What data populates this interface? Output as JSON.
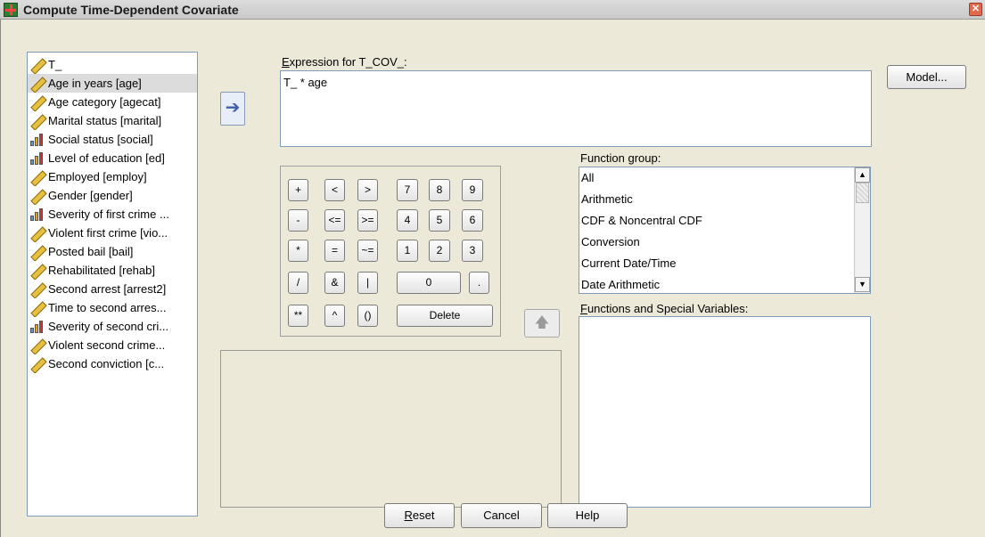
{
  "window": {
    "title": "Compute Time-Dependent Covariate",
    "close_glyph": "✕"
  },
  "variables": [
    {
      "label": "T_",
      "icon": "scale-ruler-icon"
    },
    {
      "label": "Age in years [age]",
      "icon": "scale-ruler-icon",
      "selected": true
    },
    {
      "label": "Age category [agecat]",
      "icon": "scale-ruler-icon"
    },
    {
      "label": "Marital status [marital]",
      "icon": "scale-ruler-icon"
    },
    {
      "label": "Social status [social]",
      "icon": "ordinal-bars-icon"
    },
    {
      "label": "Level of education [ed]",
      "icon": "ordinal-bars-icon"
    },
    {
      "label": "Employed [employ]",
      "icon": "scale-ruler-icon"
    },
    {
      "label": "Gender [gender]",
      "icon": "scale-ruler-icon"
    },
    {
      "label": "Severity of first crime ...",
      "icon": "ordinal-bars-icon"
    },
    {
      "label": "Violent first crime [vio...",
      "icon": "scale-ruler-icon"
    },
    {
      "label": "Posted bail [bail]",
      "icon": "scale-ruler-icon"
    },
    {
      "label": "Rehabilitated [rehab]",
      "icon": "scale-ruler-icon"
    },
    {
      "label": "Second arrest [arrest2]",
      "icon": "scale-ruler-icon"
    },
    {
      "label": "Time to second arres...",
      "icon": "scale-ruler-icon"
    },
    {
      "label": "Severity of second cri...",
      "icon": "ordinal-bars-icon"
    },
    {
      "label": "Violent second crime...",
      "icon": "scale-ruler-icon"
    },
    {
      "label": "Second conviction [c...",
      "icon": "scale-ruler-icon"
    }
  ],
  "move_button": {
    "glyph": "➔"
  },
  "expression": {
    "label_u": "E",
    "label_rest": "xpression for T_COV_:",
    "value": "T_ * age"
  },
  "model_button": {
    "label": "Model..."
  },
  "keypad": {
    "keys": [
      "+",
      "<",
      ">",
      "7",
      "8",
      "9",
      "-",
      "<=",
      ">=",
      "4",
      "5",
      "6",
      "*",
      "=",
      "~=",
      "1",
      "2",
      "3",
      "/",
      "&",
      "|",
      "0",
      ".",
      "**",
      "^",
      "()",
      "Delete"
    ]
  },
  "up_button": {
    "glyph": "🡅"
  },
  "function_group": {
    "label_pre": "Function ",
    "label_u": "g",
    "label_post": "roup:",
    "items": [
      "All",
      "Arithmetic",
      "CDF & Noncentral CDF",
      "Conversion",
      "Current Date/Time",
      "Date Arithmetic"
    ]
  },
  "functions_special": {
    "label_u": "F",
    "label_rest": "unctions and Special Variables:"
  },
  "buttons": {
    "reset_u": "R",
    "reset_rest": "eset",
    "cancel": "Cancel",
    "help": "Help"
  },
  "scrollbar": {
    "up": "▲",
    "down": "▼"
  }
}
